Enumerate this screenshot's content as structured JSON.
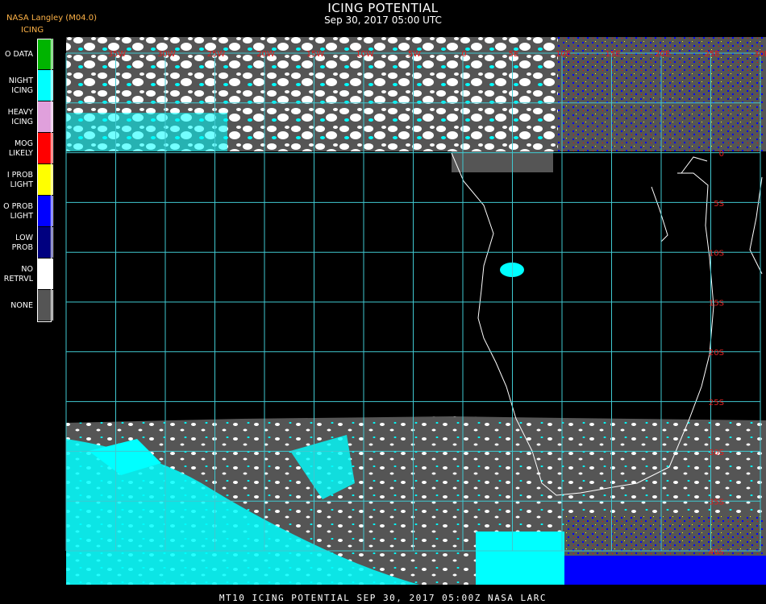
{
  "header": {
    "title": "ICING POTENTIAL",
    "subtitle": "Sep 30, 2017 05:00 UTC",
    "source": "NASA Langley (M04.0)",
    "legend_title": "ICING"
  },
  "legend": [
    {
      "label": "O DATA",
      "color": "#00b400"
    },
    {
      "label": "NIGHT\nICING",
      "color": "#00ffff"
    },
    {
      "label": "HEAVY\nICING",
      "color": "#e0a0dc"
    },
    {
      "label": "MOG\nLIKELY",
      "color": "#ff0000"
    },
    {
      "label": "I PROB\nLIGHT",
      "color": "#ffff00"
    },
    {
      "label": "O PROB\nLIGHT",
      "color": "#0000ff"
    },
    {
      "label": "LOW\nPROB",
      "color": "#000080"
    },
    {
      "label": "NO\nRETRVL",
      "color": "#ffffff"
    },
    {
      "label": "NONE",
      "color": "#555555"
    }
  ],
  "map": {
    "grid_color": "#40c8d0",
    "label_color": "#e02020",
    "lon_labels": [
      "35W",
      "30W",
      "25W",
      "20W",
      "15W",
      "10W",
      "5W",
      "0",
      "5E",
      "10E",
      "15E",
      "20E",
      "25E",
      "30E",
      "35E"
    ],
    "lat_labels": [
      "0",
      "5S",
      "10S",
      "15S",
      "20S",
      "25S",
      "30S",
      "35S",
      "40S"
    ]
  },
  "footer": "MT10  ICING POTENTIAL   SEP 30, 2017 05:00Z   NASA LARC"
}
